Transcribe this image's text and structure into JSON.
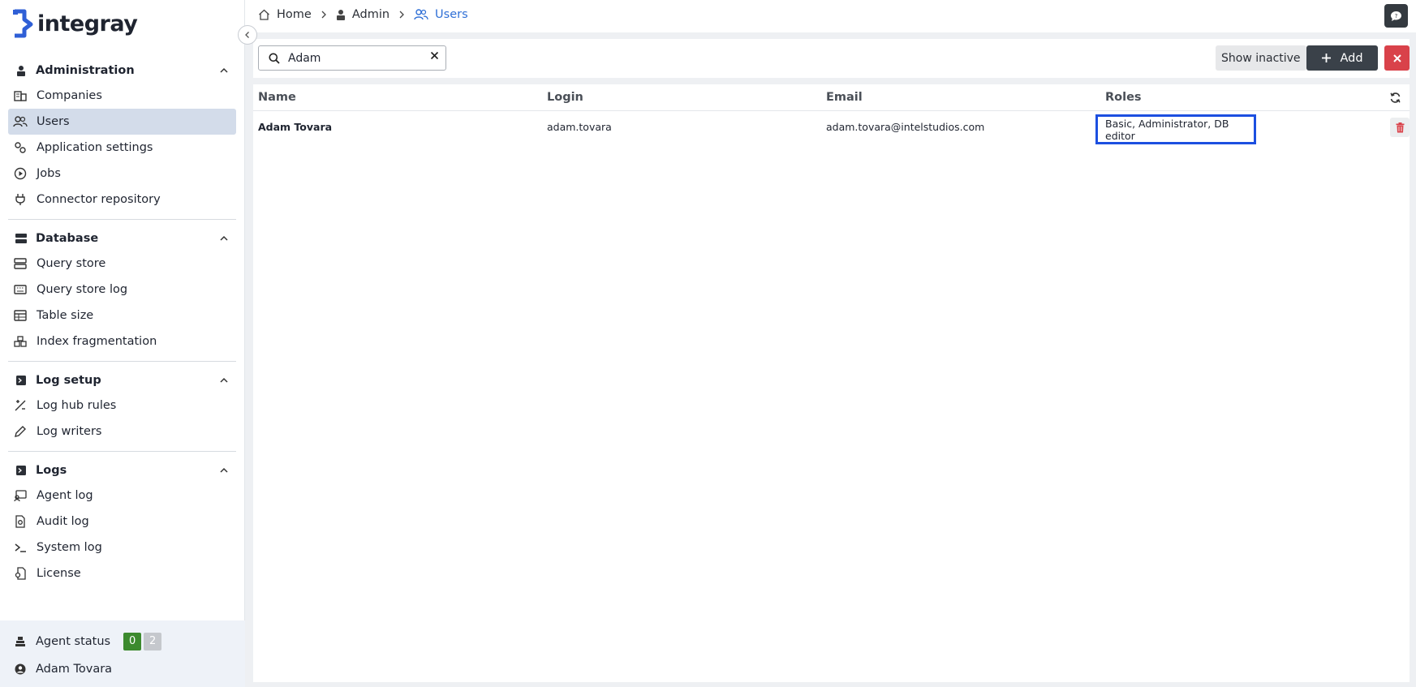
{
  "app": {
    "logo_text": "integray"
  },
  "sidebar": {
    "sections": [
      {
        "title": "Administration",
        "items": [
          "Companies",
          "Users",
          "Application settings",
          "Jobs",
          "Connector repository"
        ]
      },
      {
        "title": "Database",
        "items": [
          "Query store",
          "Query store log",
          "Table size",
          "Index fragmentation"
        ]
      },
      {
        "title": "Log setup",
        "items": [
          "Log hub rules",
          "Log writers"
        ]
      },
      {
        "title": "Logs",
        "items": [
          "Agent log",
          "Audit log",
          "System log",
          "License"
        ]
      }
    ],
    "active_item": "Users",
    "agent_status_label": "Agent status",
    "agent_status_ok": "0",
    "agent_status_other": "2",
    "user_name": "Adam Tovara"
  },
  "breadcrumb": {
    "home": "Home",
    "admin": "Admin",
    "current": "Users"
  },
  "toolbar": {
    "search_value": "Adam",
    "show_inactive_label": "Show inactive",
    "add_label": "Add"
  },
  "table": {
    "columns": {
      "name": "Name",
      "login": "Login",
      "email": "Email",
      "roles": "Roles"
    },
    "rows": [
      {
        "name": "Adam Tovara",
        "login": "adam.tovara",
        "email": "adam.tovara@intelstudios.com",
        "roles": "Basic, Administrator, DB editor"
      }
    ]
  },
  "colors": {
    "accent": "#2f6fd6",
    "active_nav": "#d3dcea",
    "danger": "#d9424a",
    "dark_button": "#3a4149",
    "status_green": "#3c8a2e",
    "highlight_border": "#1c4fe0"
  }
}
